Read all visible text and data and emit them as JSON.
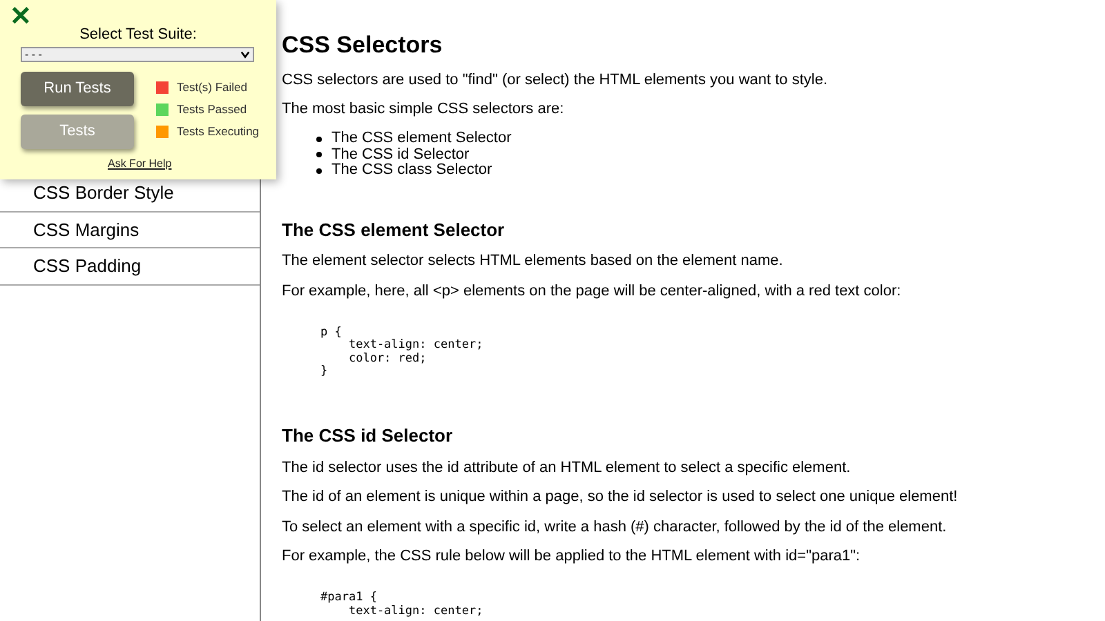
{
  "sidebar": {
    "items": [
      {
        "label": "CSS Border Style",
        "selected": false
      },
      {
        "label": "CSS Margins",
        "selected": false
      },
      {
        "label": "CSS Padding",
        "selected": false
      }
    ]
  },
  "test_panel": {
    "close": "✕",
    "title": "Select Test Suite:",
    "suite_select": {
      "value": "- - -"
    },
    "buttons": [
      {
        "label": "Run Tests",
        "disabled": false
      },
      {
        "label": "Tests",
        "disabled": true
      }
    ],
    "legend": [
      {
        "label": "Test(s) Failed",
        "color": "#f44336"
      },
      {
        "label": "Tests Passed",
        "color": "#5cd65c"
      },
      {
        "label": "Tests Executing",
        "color": "#ff9800"
      }
    ],
    "help_link": "Ask For Help"
  },
  "content": [
    {
      "kind": "h1",
      "text": "CSS Selectors"
    },
    {
      "kind": "p",
      "text": "CSS selectors are used to \"find\" (or select) the HTML elements you want to style."
    },
    {
      "kind": "p",
      "text": "The most basic simple CSS selectors are:"
    },
    {
      "kind": "ul",
      "items": [
        "The CSS element Selector",
        "The CSS id Selector",
        "The CSS class Selector"
      ]
    },
    {
      "kind": "h2",
      "text": "The CSS element Selector"
    },
    {
      "kind": "p",
      "text": "The element selector selects HTML elements based on the element name."
    },
    {
      "kind": "p",
      "text": "For example, here, all <p> elements on the page will be center-aligned, with a red text color:"
    },
    {
      "kind": "code",
      "text": "p {\n    text-align: center;\n    color: red;\n}"
    },
    {
      "kind": "h2",
      "text": "The CSS id Selector"
    },
    {
      "kind": "p",
      "text": "The id selector uses the id attribute of an HTML element to select a specific element."
    },
    {
      "kind": "p",
      "text": "The id of an element is unique within a page, so the id selector is used to select one unique element!"
    },
    {
      "kind": "p",
      "text": "To select an element with a specific id, write a hash (#) character, followed by the id of the element."
    },
    {
      "kind": "p",
      "text": "For example, the CSS rule below will be applied to the HTML element with id=\"para1\":"
    },
    {
      "kind": "code",
      "text": "#para1 {\n    text-align: center;"
    }
  ]
}
